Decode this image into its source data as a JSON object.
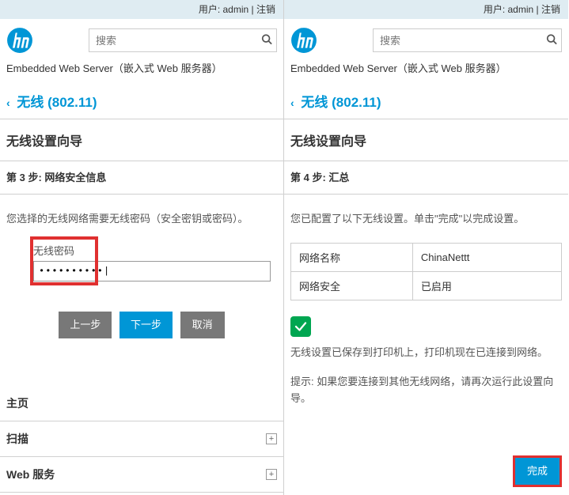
{
  "topbar": {
    "userLabel": "用户:",
    "userName": "admin",
    "sep": " | ",
    "logout": "注销"
  },
  "search": {
    "placeholder": "搜索"
  },
  "subtitle1": "Embedded Web Server",
  "subtitle2": "（嵌入式 Web 服务器）",
  "navTitle": "无线 (802.11)",
  "left": {
    "sectionHead": "无线设置向导",
    "stepTitle": "第 3 步: 网络安全信息",
    "prompt": "您选择的无线网络需要无线密码（安全密钥或密码）。",
    "fieldLabel": "无线密码",
    "fieldValue": "••••••••••|",
    "btnPrev": "上一步",
    "btnNext": "下一步",
    "btnCancel": "取消",
    "acc": [
      {
        "label": "主页",
        "expandable": false
      },
      {
        "label": "扫描",
        "expandable": true
      },
      {
        "label": "Web 服务",
        "expandable": true
      }
    ]
  },
  "right": {
    "sectionHead": "无线设置向导",
    "stepTitle": "第 4 步: 汇总",
    "prompt": "您已配置了以下无线设置。单击\"完成\"以完成设置。",
    "table": {
      "r1c1": "网络名称",
      "r1c2": "ChinaNettt",
      "r2c1": "网络安全",
      "r2c2": "已启用"
    },
    "msg1": "无线设置已保存到打印机上，打印机现在已连接到网络。",
    "msg2": "提示: 如果您要连接到其他无线网络，请再次运行此设置向导。",
    "btnFinish": "完成"
  }
}
